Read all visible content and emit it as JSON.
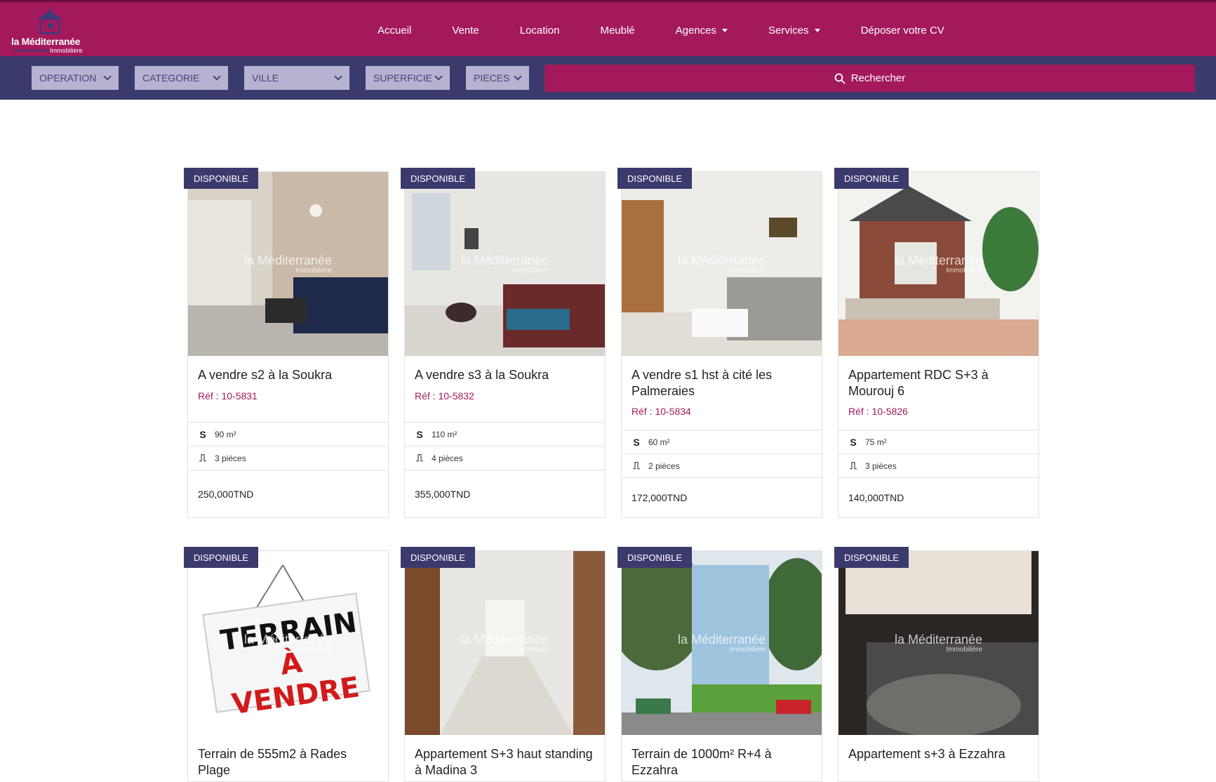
{
  "brand": {
    "name": "la Méditerranée",
    "sub": "Immobilière"
  },
  "nav": {
    "items": [
      {
        "label": "Accueil",
        "dropdown": false
      },
      {
        "label": "Vente",
        "dropdown": false
      },
      {
        "label": "Location",
        "dropdown": false
      },
      {
        "label": "Meublé",
        "dropdown": false
      },
      {
        "label": "Agences",
        "dropdown": true
      },
      {
        "label": "Services",
        "dropdown": true
      },
      {
        "label": "Déposer votre CV",
        "dropdown": false
      }
    ]
  },
  "filters": {
    "operation": "OPERATION",
    "categorie": "CATEGORIE",
    "ville": "VILLE",
    "superficie": "SUPERFICIE",
    "pieces": "PIECES",
    "search_label": "Rechercher"
  },
  "colors": {
    "brand": "#a3195b",
    "navy": "#3b3a6d",
    "select_bg": "#b6b3d1"
  },
  "listings": [
    {
      "badge": "DISPONIBLE",
      "title": "A vendre s2 à la Soukra",
      "ref": "Réf : 10-5831",
      "surface": "90 m²",
      "pieces": "3 pièces",
      "price": "250,000TND",
      "watermark": "la Méditerranée",
      "watermark_sub": "Immobilière"
    },
    {
      "badge": "DISPONIBLE",
      "title": "A vendre s3 à la Soukra",
      "ref": "Réf : 10-5832",
      "surface": "110 m²",
      "pieces": "4 pièces",
      "price": "355,000TND",
      "watermark": "la Méditerranée",
      "watermark_sub": "Immobilière"
    },
    {
      "badge": "DISPONIBLE",
      "title": "A vendre s1 hst à cité les Palmeraies",
      "ref": "Réf : 10-5834",
      "surface": "60 m²",
      "pieces": "2 pièces",
      "price": "172,000TND",
      "watermark": "la Méditerranée",
      "watermark_sub": "Immobilière"
    },
    {
      "badge": "DISPONIBLE",
      "title": "Appartement RDC S+3 à Mourouj 6",
      "ref": "Réf : 10-5826",
      "surface": "75 m²",
      "pieces": "3 pièces",
      "price": "140,000TND",
      "watermark": "la Méditerranée",
      "watermark_sub": "Immobilière"
    },
    {
      "badge": "DISPONIBLE",
      "title": "Terrain de 555m2 à Rades Plage",
      "sign_line1": "TERRAIN",
      "sign_line2": "À VENDRE",
      "watermark": "la Méditerranée",
      "watermark_sub": "Immobilière"
    },
    {
      "badge": "DISPONIBLE",
      "title": "Appartement S+3 haut standing à Madina 3",
      "watermark": "la Méditerranée",
      "watermark_sub": "Immobilière"
    },
    {
      "badge": "DISPONIBLE",
      "title": "Terrain de 1000m² R+4 à Ezzahra",
      "watermark": "la Méditerranée",
      "watermark_sub": "Immobilière"
    },
    {
      "badge": "DISPONIBLE",
      "title": "Appartement s+3 à Ezzahra",
      "watermark": "la Méditerranée",
      "watermark_sub": "Immobilière"
    }
  ]
}
